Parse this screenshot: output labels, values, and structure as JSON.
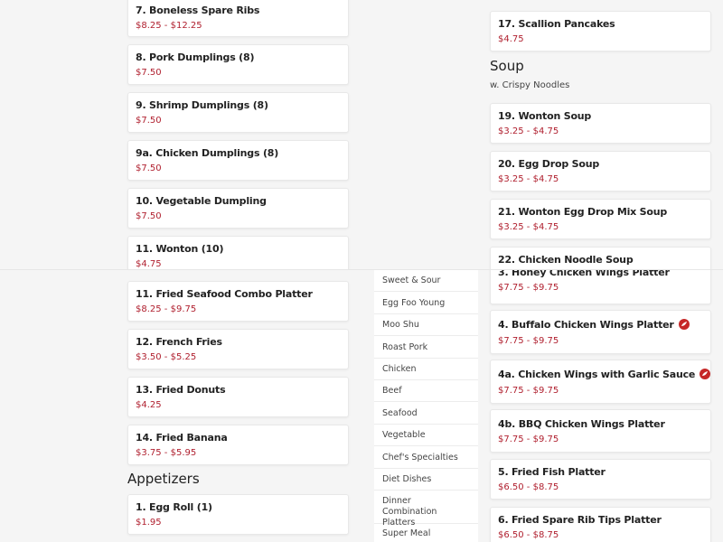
{
  "top_left_items": [
    {
      "name": "7. Boneless Spare Ribs",
      "price": "$8.25 - $12.25"
    },
    {
      "name": "8. Pork Dumplings (8)",
      "price": "$7.50"
    },
    {
      "name": "9. Shrimp Dumplings (8)",
      "price": "$7.50"
    },
    {
      "name": "9a. Chicken Dumplings (8)",
      "price": "$7.50"
    },
    {
      "name": "10. Vegetable Dumpling",
      "price": "$7.50"
    },
    {
      "name": "11. Wonton (10)",
      "price": "$4.75"
    }
  ],
  "top_right": {
    "item_17": {
      "name": "17. Scallion Pancakes",
      "price": "$4.75"
    },
    "soup_section": {
      "title": "Soup",
      "subtitle": "w. Crispy Noodles"
    },
    "soups": [
      {
        "name": "19. Wonton Soup",
        "price": "$3.25 - $4.75"
      },
      {
        "name": "20. Egg Drop Soup",
        "price": "$3.25 - $4.75"
      },
      {
        "name": "21. Wonton Egg Drop Mix Soup",
        "price": "$3.25 - $4.75"
      },
      {
        "name": "22. Chicken Noodle Soup",
        "price": ""
      }
    ]
  },
  "bottom_left_items": [
    {
      "name": "11. Fried Seafood Combo Platter",
      "price": "$8.25 - $9.75"
    },
    {
      "name": "12. French Fries",
      "price": "$3.50 - $5.25"
    },
    {
      "name": "13. Fried Donuts",
      "price": "$4.25"
    },
    {
      "name": "14. Fried Banana",
      "price": "$3.75 - $5.95"
    }
  ],
  "appetizers_section": {
    "title": "Appetizers"
  },
  "appetizers": [
    {
      "name": "1. Egg Roll (1)",
      "price": "$1.95"
    }
  ],
  "category_nav": [
    "Sweet & Sour",
    "Egg Foo Young",
    "Moo Shu",
    "Roast Pork",
    "Chicken",
    "Beef",
    "Seafood",
    "Vegetable",
    "Chef's Specialties",
    "Diet Dishes",
    "Dinner Combination Platters",
    "Super Meal"
  ],
  "bottom_right_items": [
    {
      "name": "3. Honey Chicken Wings Platter",
      "price": "$7.75 - $9.75",
      "spicy": false
    },
    {
      "name": "4. Buffalo Chicken Wings Platter",
      "price": "$7.75 - $9.75",
      "spicy": true
    },
    {
      "name": "4a. Chicken Wings with Garlic Sauce",
      "price": "$7.75 - $9.75",
      "spicy": true
    },
    {
      "name": "4b. BBQ Chicken Wings Platter",
      "price": "$7.75 - $9.75",
      "spicy": false
    },
    {
      "name": "5. Fried Fish Platter",
      "price": "$6.50 - $8.75",
      "spicy": false
    },
    {
      "name": "6. Fried Spare Rib Tips Platter",
      "price": "$6.50 - $8.75",
      "spicy": false
    }
  ],
  "colors": {
    "price": "#b0202f",
    "spicy_badge": "#c62828",
    "background": "#f5f5f5"
  },
  "icons": {
    "spicy": "chili-pepper-icon"
  }
}
